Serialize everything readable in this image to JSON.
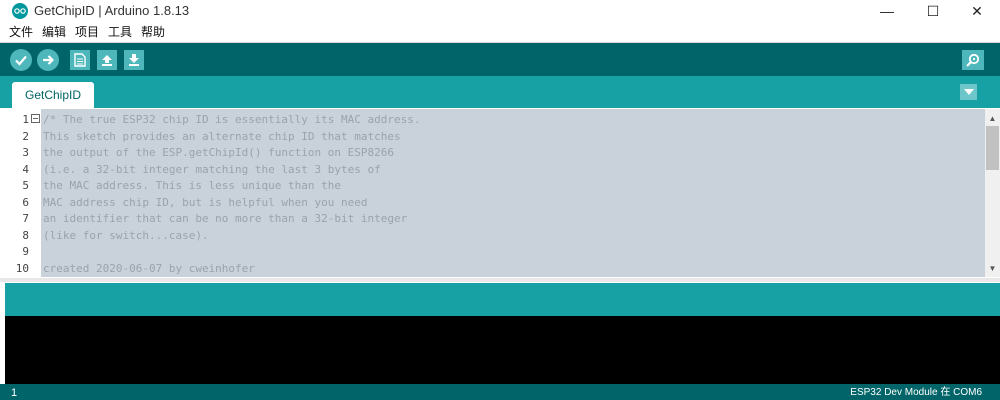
{
  "window": {
    "title": "GetChipID | Arduino 1.8.13",
    "minimize": "—",
    "maximize": "☐",
    "close": "✕"
  },
  "menu": [
    "文件",
    "编辑",
    "项目",
    "工具",
    "帮助"
  ],
  "toolbar": {
    "verify": "verify-icon",
    "upload": "upload-icon",
    "new": "new-file-icon",
    "open": "open-icon",
    "save": "save-icon",
    "serial_monitor": "serial-monitor-icon"
  },
  "tabs": [
    {
      "label": "GetChipID"
    }
  ],
  "editor": {
    "line_numbers": [
      "1",
      "2",
      "3",
      "4",
      "5",
      "6",
      "7",
      "8",
      "9",
      "10"
    ],
    "lines": [
      "/* The true ESP32 chip ID is essentially its MAC address.",
      "This sketch provides an alternate chip ID that matches",
      "the output of the ESP.getChipId() function on ESP8266",
      "(i.e. a 32-bit integer matching the last 3 bytes of",
      "the MAC address. This is less unique than the",
      "MAC address chip ID, but is helpful when you need",
      "an identifier that can be no more than a 32-bit integer",
      "(like for switch...case).",
      "",
      "created 2020-06-07 by cweinhofer"
    ]
  },
  "status": {
    "line": "1",
    "board": "ESP32 Dev Module 在 COM6"
  },
  "colors": {
    "toolbar": "#006468",
    "tabbar": "#17a1a5",
    "editor_bg": "#c9d2db",
    "console": "#000000"
  }
}
